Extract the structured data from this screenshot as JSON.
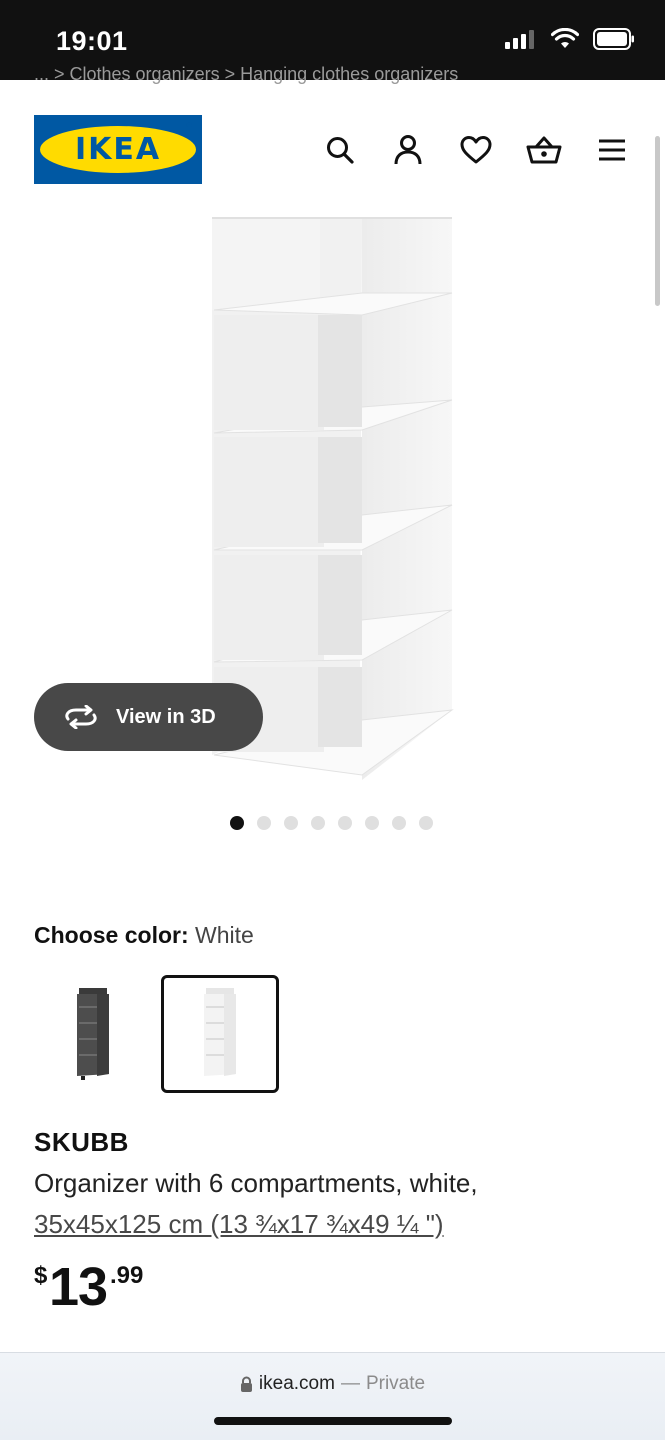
{
  "status_bar": {
    "time": "19:01"
  },
  "breadcrumb": "... > Clothes organizers > Hanging clothes organizers",
  "header": {
    "logo_text": "IKEA",
    "icons": [
      "search-icon",
      "user-icon",
      "heart-icon",
      "basket-icon",
      "menu-icon"
    ]
  },
  "gallery": {
    "view_3d_label": "View in 3D",
    "dot_count": 8,
    "active_dot": 0
  },
  "color_chooser": {
    "label": "Choose color:",
    "selected": "White",
    "options": [
      "Dark grey",
      "White"
    ]
  },
  "product": {
    "name": "SKUBB",
    "description": "Organizer with 6 compartments, white,",
    "size": "35x45x125 cm (13 ¾x17 ¾x49 ¼ \")",
    "price_currency": "$",
    "price_integer": "13",
    "price_decimal": ".99"
  },
  "address_bar": {
    "domain": "ikea.com",
    "separator": "—",
    "mode": "Private"
  },
  "colors": {
    "ikea_blue": "#0058a3",
    "ikea_yellow": "#ffdb00",
    "button_dark": "#484848"
  }
}
